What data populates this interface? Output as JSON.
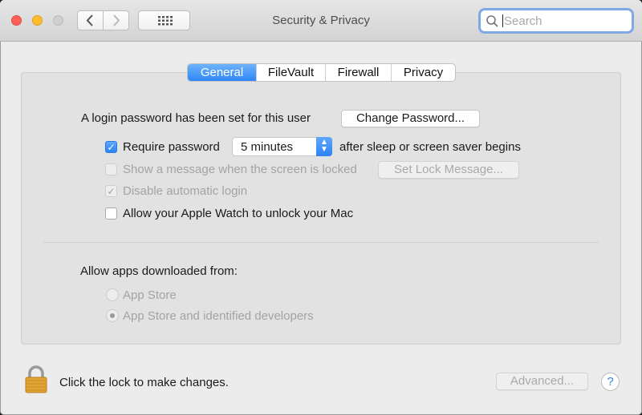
{
  "window": {
    "title": "Security & Privacy",
    "search": {
      "placeholder": "Search",
      "value": ""
    },
    "icons": {
      "back": "chevron-left-icon",
      "forward": "chevron-right-icon",
      "show_all": "grid-icon",
      "search": "magnifier-icon",
      "lock": "lock-icon",
      "help": "help-icon"
    },
    "colors": {
      "close": "#fe5f57",
      "minimize": "#febc2e",
      "zoom_disabled": "#cfcfcf",
      "accent": "#2e86f6"
    }
  },
  "tabs": [
    {
      "label": "General",
      "selected": true
    },
    {
      "label": "FileVault",
      "selected": false
    },
    {
      "label": "Firewall",
      "selected": false
    },
    {
      "label": "Privacy",
      "selected": false
    }
  ],
  "general": {
    "login_text": "A login password has been set for this user",
    "change_password_button": "Change Password...",
    "require_password": {
      "label": "Require password",
      "checked": true,
      "delay": "5 minutes",
      "suffix": "after sleep or screen saver begins"
    },
    "show_message": {
      "label": "Show a message when the screen is locked",
      "checked": false,
      "enabled": false,
      "button": "Set Lock Message..."
    },
    "disable_auto_login": {
      "label": "Disable automatic login",
      "checked": true,
      "enabled": false
    },
    "apple_watch": {
      "label": "Allow your Apple Watch to unlock your Mac",
      "checked": false
    }
  },
  "downloads": {
    "heading": "Allow apps downloaded from:",
    "options": [
      {
        "label": "App Store",
        "selected": false
      },
      {
        "label": "App Store and identified developers",
        "selected": true
      }
    ]
  },
  "footer": {
    "lock_text": "Click the lock to make changes.",
    "advanced_button": "Advanced...",
    "help_label": "?"
  }
}
